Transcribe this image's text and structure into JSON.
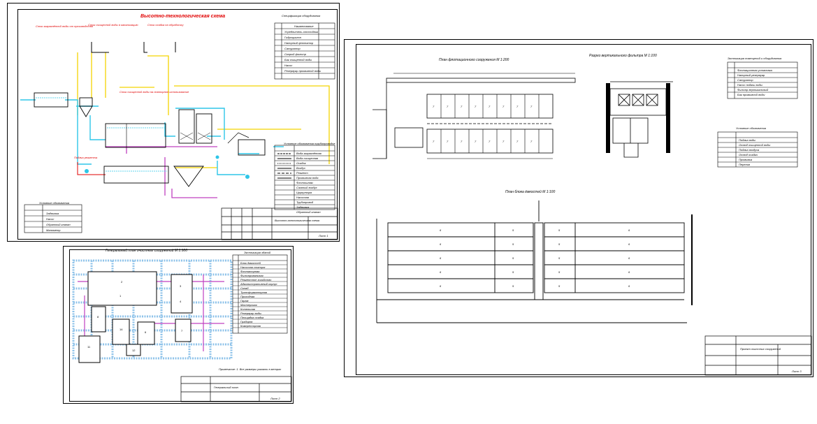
{
  "sheet1": {
    "title": "Высотно-технологическая схема",
    "labels": {
      "from_sewer": "Сток загрязнённой воды от производства",
      "to_sewer": "Сток очищенной воды в канализацию",
      "to_treatment": "Сток осадка на обработку",
      "recycled": "Сток очищенной воды на повторное использование",
      "reagent": "Подача реагента"
    },
    "spec_title": "Спецификация оборудования",
    "spec_header": "Наименование",
    "spec_rows": [
      "Усреднитель-отстойник",
      "Гидроциклон",
      "Напорный флотатор",
      "Сатуратор",
      "Скорый фильтр",
      "Бак очищенной воды",
      "Насос",
      "Резервуар промывной воды"
    ],
    "legend_title": "Условные обозначения трубопроводов",
    "legend_rows": [
      "Вода загрязнённая",
      "Вода очищенная",
      "Осадок",
      "Воздух",
      "Реагент",
      "Промывная вода",
      "Флотошлам",
      "Сжатый воздух",
      "Циркуляция",
      "Насосная",
      "Трубопровод",
      "Задвижка",
      "Обратный клапан"
    ],
    "symbols_title": "Условные обозначения",
    "symbol_rows": [
      "Задвижка",
      "Насос",
      "Обратный клапан",
      "Манометр"
    ],
    "stamp_title": "Высотно-технологическая схема",
    "sheet_no": "Лист 1"
  },
  "sheet2": {
    "title": "Генеральный план очистных сооружений М 1:500",
    "expl_title": "Экспликация зданий",
    "expl_rows": [
      "Блок ёмкостей",
      "Насосная станция",
      "Флотаторная",
      "Фильтровальная",
      "Реагентное хозяйство",
      "Административный корпус",
      "Склад",
      "Трансформаторная",
      "Проходная",
      "Гараж",
      "Мастерская",
      "Котельная",
      "Резервуар воды",
      "Площадка осадка",
      "Градирня",
      "Компрессорная"
    ],
    "note": "Примечание: 1. Все размеры указаны в метрах",
    "stamp_title": "Генеральный план",
    "sheet_no": "Лист 2"
  },
  "sheet3": {
    "plan1_title": "План флотационного сооружения М 1:200",
    "section_title": "Разрез вертикального фильтра М 1:100",
    "plan2_title": "План блока ёмкостей М 1:100",
    "expl_title": "Экспликация помещений и оборудования",
    "expl_rows": [
      "Флотационная установка",
      "Напорный резервуар",
      "Сатуратор",
      "Насос подачи воды",
      "Фильтр вертикальный",
      "Бак промывной воды"
    ],
    "legend_title": "Условные обозначения",
    "legend_rows": [
      "Подача воды",
      "Отвод очищенной воды",
      "Подача воздуха",
      "Отвод осадка",
      "Промывка",
      "Перелив"
    ],
    "cell_nums_left": [
      "6",
      "6",
      "6",
      "6",
      "6"
    ],
    "cell_nums_mid": [
      "5",
      "5",
      "5",
      "5",
      "5"
    ],
    "cell_nums_right": [
      "6",
      "6",
      "6",
      "6",
      "6"
    ],
    "flot_nums": [
      "7",
      "7",
      "7",
      "7",
      "7",
      "7",
      "7",
      "7"
    ],
    "stamp_title": "Проект очистных сооружений",
    "sheet_no": "Лист 3"
  }
}
